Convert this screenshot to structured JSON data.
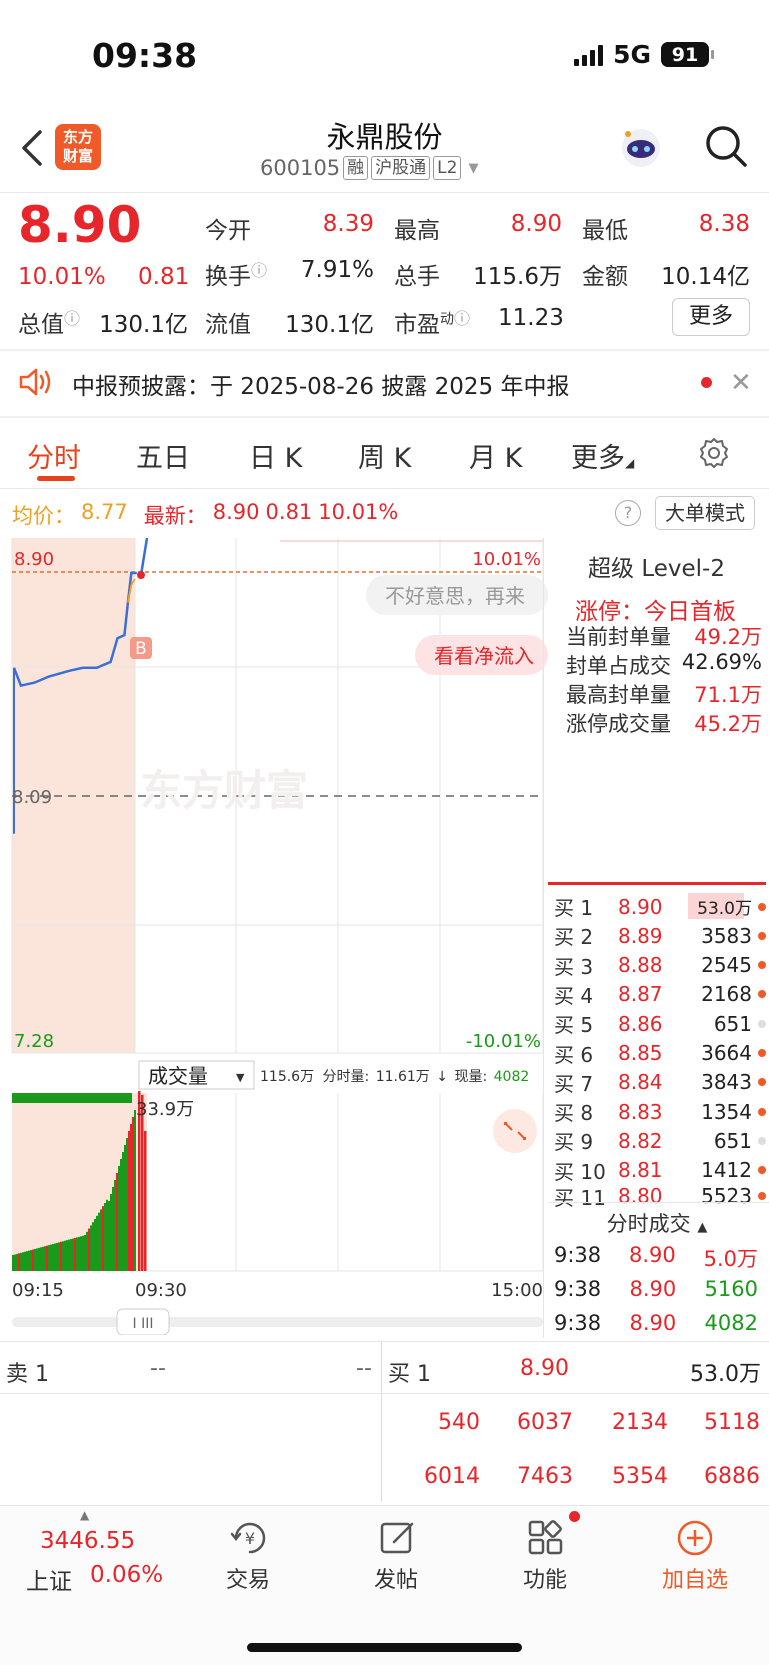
{
  "status": {
    "time": "09:38",
    "network": "5G",
    "battery": "91"
  },
  "header": {
    "logo_line1": "东方",
    "logo_line2": "财富",
    "stock_name": "永鼎股份",
    "code": "600105",
    "tags": [
      "融",
      "沪股通",
      "L2"
    ]
  },
  "quote": {
    "price": "8.90",
    "change_pct": "10.01%",
    "change": "0.81",
    "open_label": "今开",
    "open": "8.39",
    "high_label": "最高",
    "high": "8.90",
    "low_label": "最低",
    "low": "8.38",
    "turnover_label": "换手",
    "turnover": "7.91%",
    "volume_label": "总手",
    "volume": "115.6万",
    "amount_label": "金额",
    "amount": "10.14亿",
    "mktcap_label": "总值",
    "mktcap": "130.1亿",
    "float_label": "流值",
    "float": "130.1亿",
    "pe_label": "市盈",
    "pe_sup": "动",
    "pe": "11.23",
    "more_label": "更多"
  },
  "notice": {
    "text": "中报预披露：于 2025-08-26 披露 2025 年中报"
  },
  "tabs": [
    "分时",
    "五日",
    "日 K",
    "周 K",
    "月 K",
    "更多"
  ],
  "info": {
    "avg_label": "均价：",
    "avg": "8.77",
    "latest_label": "最新：",
    "latest": "8.90",
    "latest_chg": "0.81",
    "latest_pct": "10.01%",
    "help": "?",
    "big_order_label": "大单模式"
  },
  "chart_data": {
    "type": "line",
    "title": "",
    "price_axis": {
      "top": "8.90",
      "mid": "8.09",
      "bottom": "7.28",
      "top_pct": "10.01%",
      "bottom_pct": "-10.01%"
    },
    "x_labels": [
      "09:15",
      "09:30",
      "15:00"
    ],
    "series": [
      {
        "name": "",
        "color": "#3b6fd4",
        "points": [
          [
            0,
            8.58
          ],
          [
            1,
            8.52
          ],
          [
            3,
            8.53
          ],
          [
            5,
            8.55
          ],
          [
            8,
            8.57
          ],
          [
            10,
            8.58
          ],
          [
            12,
            8.58
          ],
          [
            14,
            8.6
          ],
          [
            15,
            8.68
          ],
          [
            16,
            8.69
          ],
          [
            16.5,
            8.8
          ],
          [
            17,
            8.9
          ],
          [
            17.8,
            8.9
          ]
        ]
      },
      {
        "name": "",
        "color": "#f0a020",
        "points": [
          [
            16.5,
            8.8
          ],
          [
            17,
            8.86
          ],
          [
            17.5,
            8.88
          ]
        ]
      }
    ],
    "overlay": {
      "sorry": "不好意思，再来",
      "netflow": "看看净流入",
      "b_marker": "B",
      "watermark": "东方财富"
    },
    "volume": {
      "selector_label": "成交量",
      "summary_total": "115.6万",
      "summary_min_label": "分时量:",
      "summary_min": "11.61万",
      "summary_now_label": "现量:",
      "summary_now": "4082",
      "max_label": "33.9万"
    }
  },
  "level2": {
    "title": "超级 Level-2",
    "limit_status": "涨停：今日首板",
    "stats": [
      {
        "k": "当前封单量",
        "v": "49.2万"
      },
      {
        "k": "封单占成交",
        "v": "42.69%"
      },
      {
        "k": "最高封单量",
        "v": "71.1万"
      },
      {
        "k": "涨停成交量",
        "v": "45.2万"
      }
    ],
    "book": [
      {
        "label": "买 1",
        "price": "8.90",
        "vol": "53.0万"
      },
      {
        "label": "买 2",
        "price": "8.89",
        "vol": "3583"
      },
      {
        "label": "买 3",
        "price": "8.88",
        "vol": "2545"
      },
      {
        "label": "买 4",
        "price": "8.87",
        "vol": "2168"
      },
      {
        "label": "买 5",
        "price": "8.86",
        "vol": "651"
      },
      {
        "label": "买 6",
        "price": "8.85",
        "vol": "3664"
      },
      {
        "label": "买 7",
        "price": "8.84",
        "vol": "3843"
      },
      {
        "label": "买 8",
        "price": "8.83",
        "vol": "1354"
      },
      {
        "label": "买 9",
        "price": "8.82",
        "vol": "651"
      },
      {
        "label": "买 10",
        "price": "8.81",
        "vol": "1412"
      },
      {
        "label": "买 11",
        "price": "8.80",
        "vol": "5523"
      }
    ],
    "ticks_title": "分时成交",
    "ticks": [
      {
        "t": "9:38",
        "p": "8.90",
        "v": "5.0万"
      },
      {
        "t": "9:38",
        "p": "8.90",
        "v": "5160"
      },
      {
        "t": "9:38",
        "p": "8.90",
        "v": "4082"
      }
    ]
  },
  "bottom_book": {
    "sell_label": "卖 1",
    "sell_price": "--",
    "sell_vol": "--",
    "buy_label": "买 1",
    "buy_price": "8.90",
    "buy_vol": "53.0万",
    "queue": [
      "540",
      "6037",
      "2134",
      "5118",
      "6014",
      "7463",
      "5354",
      "6886"
    ]
  },
  "nav": {
    "index_value": "3446.55",
    "index_name": "上证",
    "index_pct": "0.06%",
    "items": [
      "交易",
      "发帖",
      "功能",
      "加自选"
    ]
  },
  "colors": {
    "up": "#e6262a",
    "down": "#1a9a1a",
    "accent": "#f05a28",
    "line": "#3b6fd4",
    "avg": "#f0a020"
  }
}
